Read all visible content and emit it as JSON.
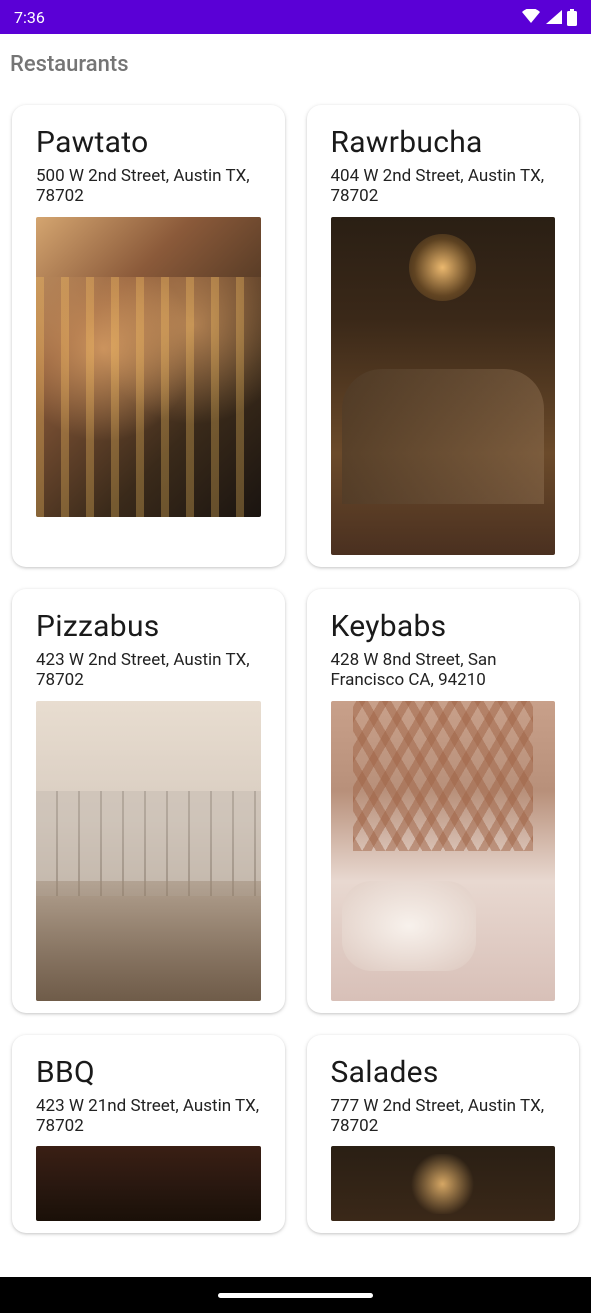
{
  "status": {
    "time": "7:36"
  },
  "page": {
    "title": "Restaurants"
  },
  "restaurants": [
    {
      "name": "Pawtato",
      "address": "500 W 2nd Street, Austin TX, 78702"
    },
    {
      "name": "Rawrbucha",
      "address": "404 W 2nd Street, Austin TX, 78702"
    },
    {
      "name": "Pizzabus",
      "address": "423 W 2nd Street, Austin TX, 78702"
    },
    {
      "name": "Keybabs",
      "address": "428 W 8nd Street, San Francisco CA, 94210"
    },
    {
      "name": "BBQ",
      "address": "423 W 21nd Street, Austin TX, 78702"
    },
    {
      "name": "Salades",
      "address": "777 W 2nd Street, Austin TX, 78702"
    }
  ]
}
